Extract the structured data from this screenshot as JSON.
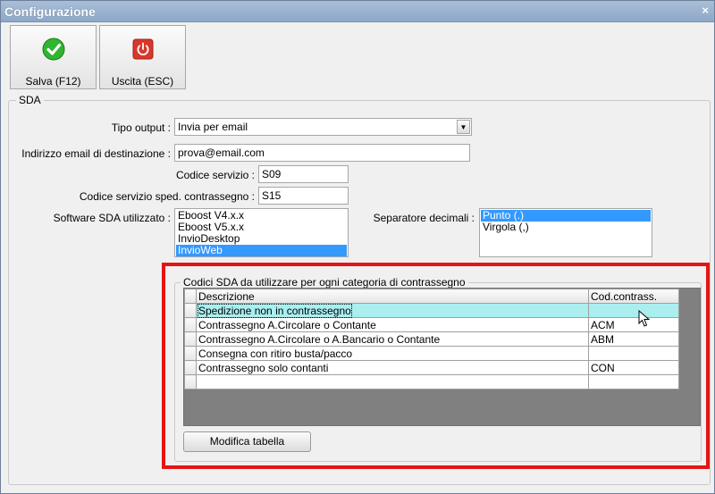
{
  "window": {
    "title": "Configurazione",
    "close_glyph": "×"
  },
  "toolbar": {
    "save_label": "Salva (F12)",
    "exit_label": "Uscita (ESC)",
    "save_icon": "check-icon",
    "exit_icon": "power-icon",
    "save_color": "#2fb52f",
    "exit_color": "#d9372c"
  },
  "group": {
    "title": "SDA",
    "tipo_output": {
      "label": "Tipo output :",
      "value": "Invia per email"
    },
    "email": {
      "label": "Indirizzo email di destinazione :",
      "value": "prova@email.com"
    },
    "codice_servizio": {
      "label": "Codice servizio :",
      "value": "S09"
    },
    "codice_contrassegno": {
      "label": "Codice servizio sped. contrassegno :",
      "value": "S15"
    },
    "software": {
      "label": "Software SDA utilizzato :",
      "items": [
        "Eboost V4.x.x",
        "Eboost V5.x.x",
        "InvioDesktop",
        "InvioWeb"
      ],
      "selected": "InvioWeb"
    },
    "separatore": {
      "label": "Separatore decimali :",
      "items": [
        "Punto (.)",
        "Virgola (,)"
      ],
      "selected": "Punto (.)"
    }
  },
  "codici": {
    "title": "Codici SDA da utilizzare per ogni categoria di contrassegno",
    "columns": [
      "Descrizione",
      "Cod.contrass."
    ],
    "rows": [
      {
        "descrizione": "Spedizione non in contrassegno",
        "codice": ""
      },
      {
        "descrizione": "Contrassegno A.Circolare o Contante",
        "codice": "ACM"
      },
      {
        "descrizione": "Contrassegno A.Circolare o A.Bancario o Contante",
        "codice": "ABM"
      },
      {
        "descrizione": "Consegna con ritiro busta/pacco",
        "codice": ""
      },
      {
        "descrizione": "Contrassegno solo contanti",
        "codice": "CON"
      },
      {
        "descrizione": "",
        "codice": ""
      }
    ],
    "button_label": "Modifica tabella"
  }
}
